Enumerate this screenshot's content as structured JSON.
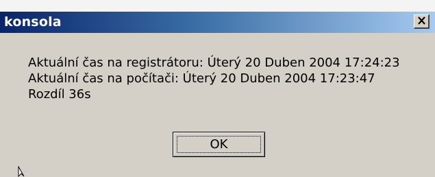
{
  "window": {
    "title": "konsola",
    "close_glyph": "✕"
  },
  "message": {
    "line1": "Aktuální čas na registrátoru: Úterý 20 Duben 2004 17:24:23",
    "line2": "Aktuální čas na počítači: Úterý 20 Duben 2004 17:23:47",
    "line3": "Rozdíl 36s"
  },
  "buttons": {
    "ok_label": "OK"
  },
  "icons": {
    "close": "close-icon",
    "cursor": "arrow-cursor-icon"
  }
}
